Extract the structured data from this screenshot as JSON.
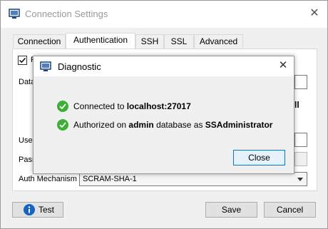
{
  "window": {
    "title": "Connection Settings",
    "tabs": [
      {
        "label": "Connection"
      },
      {
        "label": "Authentication"
      },
      {
        "label": "SSH"
      },
      {
        "label": "SSL"
      },
      {
        "label": "Advanced"
      }
    ],
    "active_tab": "Authentication",
    "fragments": {
      "checkbox_label_partial": "P",
      "database_label_partial": "Data",
      "user_label_partial": "User",
      "password_label_partial": "Pass",
      "right_partial": "ll"
    },
    "auth_mechanism": {
      "label": "Auth Mechanism",
      "value": "SCRAM-SHA-1"
    },
    "buttons": {
      "test": "Test",
      "save": "Save",
      "cancel": "Cancel"
    }
  },
  "dialog": {
    "title": "Diagnostic",
    "messages": [
      {
        "prefix": "Connected to ",
        "bold1": "localhost:27017",
        "middle": "",
        "bold2": ""
      },
      {
        "prefix": "Authorized on ",
        "bold1": "admin",
        "middle": " database as ",
        "bold2": "SSAdministrator"
      }
    ],
    "close_button": "Close"
  },
  "colors": {
    "accent": "#0078d7",
    "success": "#3bb034",
    "info": "#1565c0"
  },
  "icons": [
    "window-icon",
    "close-icon",
    "check-icon",
    "info-icon",
    "dropdown-arrow-icon"
  ]
}
